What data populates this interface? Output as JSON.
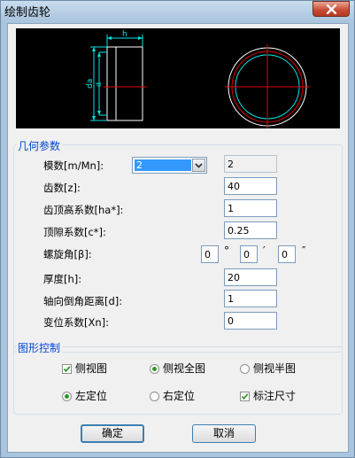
{
  "window": {
    "title": "绘制齿轮"
  },
  "preview": {
    "dim_h": "h",
    "dim_da": "da",
    "dim_d": "d"
  },
  "geometry_group": {
    "label": "几何参数",
    "fields": [
      {
        "label": "模数[m/Mn]:",
        "value": "2",
        "readout": "2"
      },
      {
        "label": "齿数[z]:",
        "value": "40"
      },
      {
        "label": "齿顶高系数[ha*]:",
        "value": "1"
      },
      {
        "label": "顶隙系数[c*]:",
        "value": "0.25"
      },
      {
        "label": "螺旋角[β]:",
        "deg": "0",
        "min": "0",
        "sec": "0",
        "deg_sym": "°",
        "min_sym": "′",
        "sec_sym": "″"
      },
      {
        "label": "厚度[h]:",
        "value": "20"
      },
      {
        "label": "轴向倒角距离[d]:",
        "value": "1"
      },
      {
        "label": "变位系数[Xn]:",
        "value": "0"
      }
    ]
  },
  "graphic_group": {
    "label": "图形控制",
    "options": [
      {
        "label": "侧视图",
        "kind": "checkbox",
        "checked": true
      },
      {
        "label": "侧视全图",
        "kind": "radio",
        "checked": true
      },
      {
        "label": "侧视半图",
        "kind": "radio",
        "checked": false
      },
      {
        "label": "左定位",
        "kind": "radio",
        "checked": true
      },
      {
        "label": "右定位",
        "kind": "radio",
        "checked": false
      },
      {
        "label": "标注尺寸",
        "kind": "checkbox",
        "checked": true
      }
    ]
  },
  "buttons": {
    "ok": "确定",
    "cancel": "取消"
  },
  "colors": {
    "dim_cyan": "#00e5e5",
    "center_red": "#e00000",
    "gear_white": "#ffffff",
    "accent_blue": "#0046d5"
  }
}
